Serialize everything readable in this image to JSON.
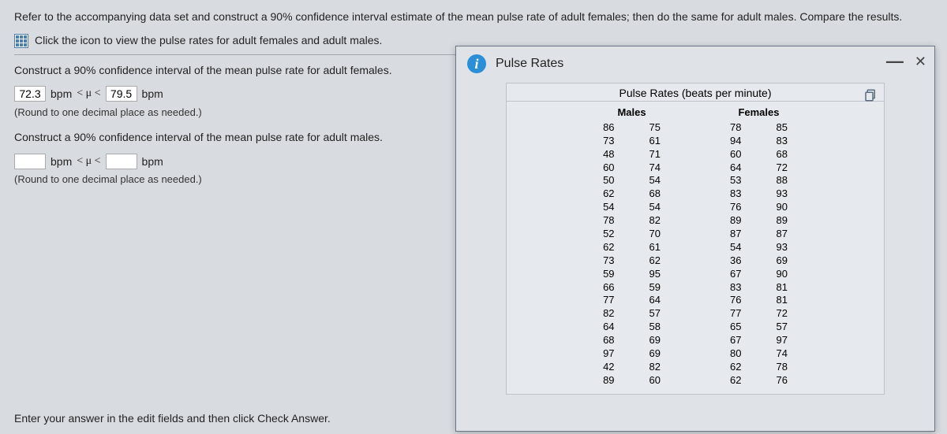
{
  "question": {
    "intro": "Refer to the accompanying data set and construct a 90% confidence interval estimate of the mean pulse rate of adult females; then do the same for adult males. Compare the results.",
    "link_text": "Click the icon to view the pulse rates for adult females and adult males.",
    "part1_prompt": "Construct a 90% confidence interval of the mean pulse rate for adult females.",
    "part1_lower": "72.3",
    "part1_upper": "79.5",
    "bpm": "bpm",
    "mu_expr": "< μ <",
    "round_hint": "(Round to one decimal place as needed.)",
    "part2_prompt": "Construct a 90% confidence interval of the mean pulse rate for adult males.",
    "bottom_status": "Enter your answer in the edit fields and then click Check Answer."
  },
  "dialog": {
    "title": "Pulse Rates",
    "box_title": "Pulse Rates (beats per minute)",
    "headers": {
      "males": "Males",
      "females": "Females"
    },
    "rows": [
      {
        "m1": "86",
        "m2": "75",
        "f1": "78",
        "f2": "85"
      },
      {
        "m1": "73",
        "m2": "61",
        "f1": "94",
        "f2": "83"
      },
      {
        "m1": "48",
        "m2": "71",
        "f1": "60",
        "f2": "68"
      },
      {
        "m1": "60",
        "m2": "74",
        "f1": "64",
        "f2": "72"
      },
      {
        "m1": "50",
        "m2": "54",
        "f1": "53",
        "f2": "88"
      },
      {
        "m1": "62",
        "m2": "68",
        "f1": "83",
        "f2": "93"
      },
      {
        "m1": "54",
        "m2": "54",
        "f1": "76",
        "f2": "90"
      },
      {
        "m1": "78",
        "m2": "82",
        "f1": "89",
        "f2": "89"
      },
      {
        "m1": "52",
        "m2": "70",
        "f1": "87",
        "f2": "87"
      },
      {
        "m1": "62",
        "m2": "61",
        "f1": "54",
        "f2": "93"
      },
      {
        "m1": "73",
        "m2": "62",
        "f1": "36",
        "f2": "69"
      },
      {
        "m1": "59",
        "m2": "95",
        "f1": "67",
        "f2": "90"
      },
      {
        "m1": "66",
        "m2": "59",
        "f1": "83",
        "f2": "81"
      },
      {
        "m1": "77",
        "m2": "64",
        "f1": "76",
        "f2": "81"
      },
      {
        "m1": "82",
        "m2": "57",
        "f1": "77",
        "f2": "72"
      },
      {
        "m1": "64",
        "m2": "58",
        "f1": "65",
        "f2": "57"
      },
      {
        "m1": "68",
        "m2": "69",
        "f1": "67",
        "f2": "97"
      },
      {
        "m1": "97",
        "m2": "69",
        "f1": "80",
        "f2": "74"
      },
      {
        "m1": "42",
        "m2": "82",
        "f1": "62",
        "f2": "78"
      },
      {
        "m1": "89",
        "m2": "60",
        "f1": "62",
        "f2": "76"
      }
    ]
  }
}
